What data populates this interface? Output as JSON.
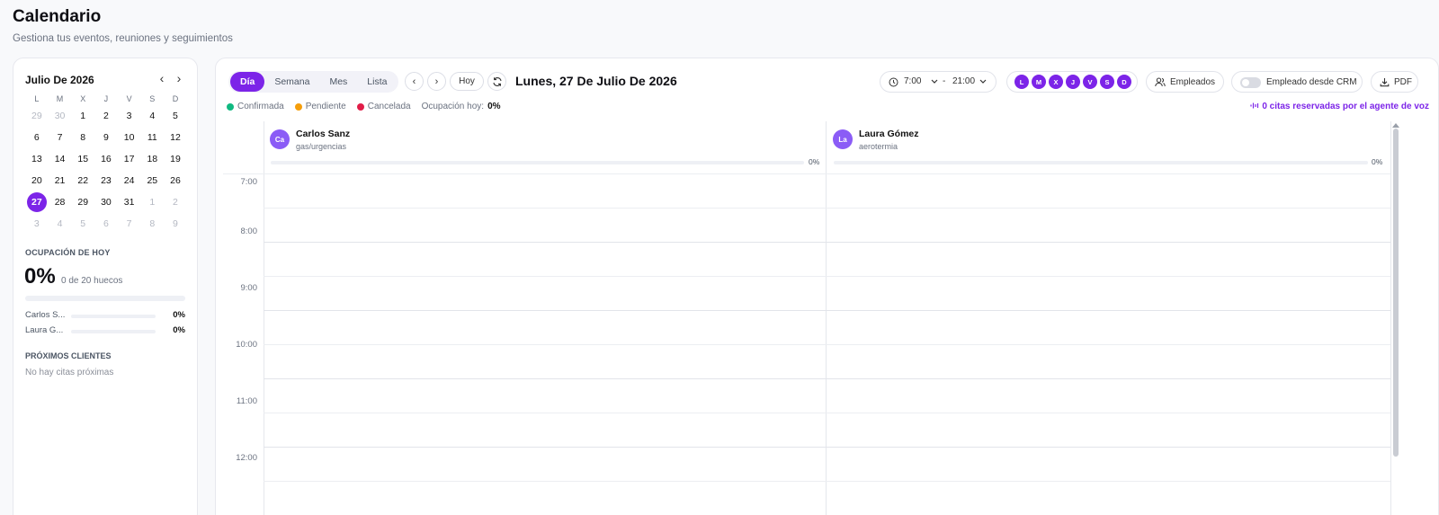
{
  "header": {
    "title": "Calendario",
    "subtitle": "Gestiona tus eventos, reuniones y seguimientos"
  },
  "mini_calendar": {
    "month_label": "Julio De 2026",
    "prev_icon": "chevron-left-icon",
    "next_icon": "chevron-right-icon",
    "weekdays": [
      "L",
      "M",
      "X",
      "J",
      "V",
      "S",
      "D"
    ],
    "days": [
      {
        "d": "29",
        "muted": true
      },
      {
        "d": "30",
        "muted": true
      },
      {
        "d": "1"
      },
      {
        "d": "2"
      },
      {
        "d": "3"
      },
      {
        "d": "4"
      },
      {
        "d": "5"
      },
      {
        "d": "6"
      },
      {
        "d": "7"
      },
      {
        "d": "8"
      },
      {
        "d": "9"
      },
      {
        "d": "10"
      },
      {
        "d": "11"
      },
      {
        "d": "12"
      },
      {
        "d": "13"
      },
      {
        "d": "14"
      },
      {
        "d": "15"
      },
      {
        "d": "16"
      },
      {
        "d": "17"
      },
      {
        "d": "18"
      },
      {
        "d": "19"
      },
      {
        "d": "20"
      },
      {
        "d": "21"
      },
      {
        "d": "22"
      },
      {
        "d": "23"
      },
      {
        "d": "24"
      },
      {
        "d": "25"
      },
      {
        "d": "26"
      },
      {
        "d": "27",
        "selected": true
      },
      {
        "d": "28"
      },
      {
        "d": "29"
      },
      {
        "d": "30"
      },
      {
        "d": "31"
      },
      {
        "d": "1",
        "muted": true
      },
      {
        "d": "2",
        "muted": true
      },
      {
        "d": "3",
        "muted": true
      },
      {
        "d": "4",
        "muted": true
      },
      {
        "d": "5",
        "muted": true
      },
      {
        "d": "6",
        "muted": true
      },
      {
        "d": "7",
        "muted": true
      },
      {
        "d": "8",
        "muted": true
      },
      {
        "d": "9",
        "muted": true
      }
    ]
  },
  "occupancy": {
    "title": "OCUPACIÓN DE HOY",
    "value": "0%",
    "detail": "0 de 20 huecos",
    "fraction": 0,
    "employees": [
      {
        "name": "Carlos S...",
        "pct": "0%"
      },
      {
        "name": "Laura G...",
        "pct": "0%"
      }
    ]
  },
  "upcoming": {
    "title": "PRÓXIMOS CLIENTES",
    "empty": "No hay citas próximas"
  },
  "toolbar": {
    "views": [
      {
        "label": "Día",
        "active": true
      },
      {
        "label": "Semana"
      },
      {
        "label": "Mes"
      },
      {
        "label": "Lista"
      }
    ],
    "prev_label": "‹",
    "next_label": "›",
    "today_label": "Hoy",
    "refresh_icon": "refresh-icon",
    "date_title": "Lunes, 27 De Julio De 2026",
    "time_from": "7:00",
    "time_sep": "-",
    "time_to": "21:00",
    "day_chips": [
      "L",
      "M",
      "X",
      "J",
      "V",
      "S",
      "D"
    ],
    "employees_label": "Empleados",
    "crm_label": "Empleado desde CRM",
    "pdf_label": "PDF"
  },
  "legend": {
    "items": [
      {
        "label": "Confirmada",
        "color": "#10b981"
      },
      {
        "label": "Pendiente",
        "color": "#f59e0b"
      },
      {
        "label": "Cancelada",
        "color": "#e11d48"
      }
    ],
    "occupancy_label": "Ocupación hoy:",
    "occupancy_value": "0%",
    "voice_text": "0 citas reservadas por el agente de voz"
  },
  "resources": [
    {
      "initials": "Ca",
      "name": "Carlos Sanz",
      "subtitle": "gas/urgencias",
      "pct": "0%"
    },
    {
      "initials": "La",
      "name": "Laura Gómez",
      "subtitle": "aerotermia",
      "pct": "0%"
    }
  ],
  "hours": [
    "7:00",
    "8:00",
    "9:00",
    "10:00",
    "11:00",
    "12:00"
  ],
  "colors": {
    "accent": "#7c24e8",
    "avatar": "#8b5cf6"
  }
}
